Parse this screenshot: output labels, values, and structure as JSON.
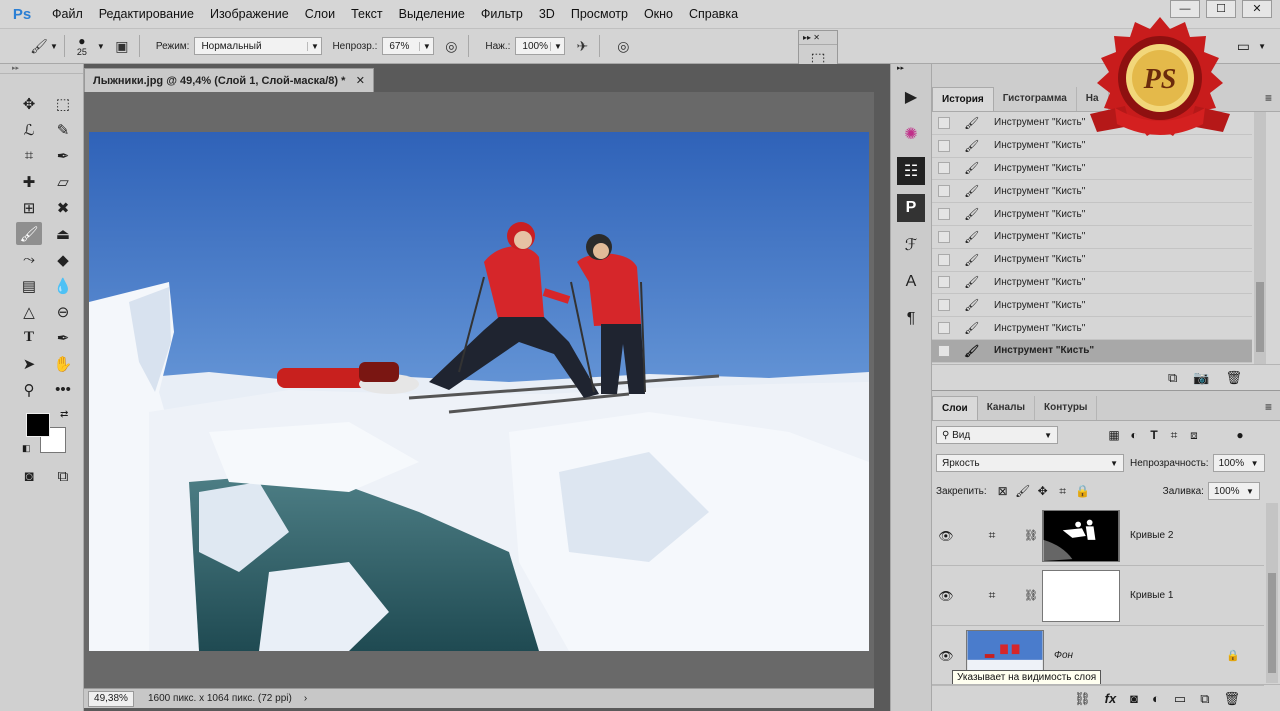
{
  "app": {
    "logo": "Ps"
  },
  "menu": [
    "Файл",
    "Редактирование",
    "Изображение",
    "Слои",
    "Текст",
    "Выделение",
    "Фильтр",
    "3D",
    "Просмотр",
    "Окно",
    "Справка"
  ],
  "options": {
    "brush_size": "25",
    "mode_label": "Режим:",
    "mode_value": "Нормальный",
    "opacity_label": "Непрозр.:",
    "opacity_value": "67%",
    "flow_label": "Наж.:",
    "flow_value": "100%"
  },
  "document": {
    "tab_title": "Лыжники.jpg @ 49,4% (Слой 1, Слой-маска/8) *",
    "zoom": "49,38%",
    "info": "1600 пикс. x 1064 пикс. (72 ppi)"
  },
  "history_panel": {
    "tabs": [
      "История",
      "Гистограмма",
      "На"
    ],
    "items": [
      "Инструмент \"Кисть\"",
      "Инструмент \"Кисть\"",
      "Инструмент \"Кисть\"",
      "Инструмент \"Кисть\"",
      "Инструмент \"Кисть\"",
      "Инструмент \"Кисть\"",
      "Инструмент \"Кисть\"",
      "Инструмент \"Кисть\"",
      "Инструмент \"Кисть\"",
      "Инструмент \"Кисть\"",
      "Инструмент \"Кисть\""
    ]
  },
  "layers_panel": {
    "tabs": [
      "Слои",
      "Каналы",
      "Контуры"
    ],
    "filter_label": "Вид",
    "blend_mode": "Яркость",
    "opacity_label": "Непрозрачность:",
    "opacity_value": "100%",
    "lock_label": "Закрепить:",
    "fill_label": "Заливка:",
    "fill_value": "100%",
    "layers": [
      {
        "name": "Кривые 2"
      },
      {
        "name": "Кривые 1"
      },
      {
        "name": "Фон"
      }
    ],
    "tooltip": "Указывает на видимость слоя"
  },
  "badge": {
    "text": "PS"
  },
  "colors": {
    "accent": "#2b7fd4",
    "panel_bg": "#d6d6d6",
    "sky": "#3c6fc4",
    "jacket": "#d6262a"
  }
}
